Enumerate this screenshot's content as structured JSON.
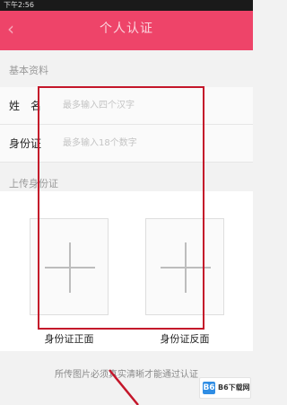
{
  "status_bar": {
    "time": "下午2:56"
  },
  "header": {
    "title": "个人认证",
    "back_icon": "back-arrow-icon"
  },
  "basic_section": {
    "title": "基本资料"
  },
  "form": {
    "name": {
      "label": "姓　名",
      "placeholder": "最多输入四个汉字"
    },
    "id_number": {
      "label": "身份证",
      "placeholder": "最多输入18个数字"
    }
  },
  "upload_section": {
    "title": "上传身份证"
  },
  "uploads": {
    "front": {
      "caption": "身份证正面",
      "icon": "plus-icon"
    },
    "back": {
      "caption": "身份证反面",
      "icon": "plus-icon"
    }
  },
  "footer": {
    "note": "所传图片必须真实清晰才能通过认证"
  },
  "watermark": {
    "logo": "B6",
    "text": "B6下载网"
  },
  "colors": {
    "accent": "#ee4469",
    "annotation": "#c4162a"
  }
}
